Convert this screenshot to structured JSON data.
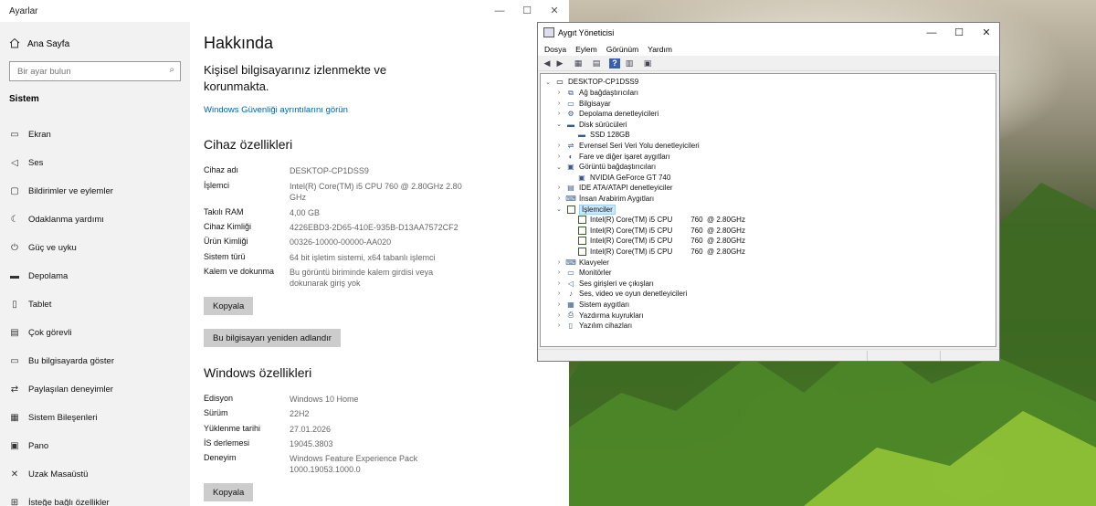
{
  "settings": {
    "app_title": "Ayarlar",
    "home_label": "Ana Sayfa",
    "search_placeholder": "Bir ayar bulun",
    "section_label": "Sistem",
    "nav_items": [
      {
        "label": "Ekran",
        "icon": "monitor-icon"
      },
      {
        "label": "Ses",
        "icon": "speaker-icon"
      },
      {
        "label": "Bildirimler ve eylemler",
        "icon": "notification-icon"
      },
      {
        "label": "Odaklanma yardımı",
        "icon": "moon-icon"
      },
      {
        "label": "Güç ve uyku",
        "icon": "power-icon"
      },
      {
        "label": "Depolama",
        "icon": "storage-icon"
      },
      {
        "label": "Tablet",
        "icon": "tablet-icon"
      },
      {
        "label": "Çok görevli",
        "icon": "multitask-icon"
      },
      {
        "label": "Bu bilgisayarda göster",
        "icon": "project-icon"
      },
      {
        "label": "Paylaşılan deneyimler",
        "icon": "shared-icon"
      },
      {
        "label": "Sistem Bileşenleri",
        "icon": "components-icon"
      },
      {
        "label": "Pano",
        "icon": "clipboard-icon"
      },
      {
        "label": "Uzak Masaüstü",
        "icon": "remote-icon"
      },
      {
        "label": "İsteğe bağlı özellikler",
        "icon": "features-icon"
      }
    ],
    "page_title": "Hakkında",
    "status_text": "Kişisel bilgisayarınız izlenmekte ve korunmakta.",
    "security_link": "Windows Güvenliği ayrıntılarını görün",
    "device_section_title": "Cihaz özellikleri",
    "device_specs": [
      {
        "key": "Cihaz adı",
        "value": "DESKTOP-CP1DSS9"
      },
      {
        "key": "İşlemci",
        "value": "Intel(R) Core(TM) i5 CPU         760  @ 2.80GHz   2.80 GHz"
      },
      {
        "key": "Takılı RAM",
        "value": "4,00 GB"
      },
      {
        "key": "Cihaz Kimliği",
        "value": "4226EBD3-2D65-410E-935B-D13AA7572CF2"
      },
      {
        "key": "Ürün Kimliği",
        "value": "00326-10000-00000-AA020"
      },
      {
        "key": "Sistem türü",
        "value": "64 bit işletim sistemi, x64 tabanlı işlemci"
      },
      {
        "key": "Kalem ve dokunma",
        "value": "Bu görüntü biriminde kalem girdisi veya dokunarak giriş yok"
      }
    ],
    "copy_label": "Kopyala",
    "rename_label": "Bu bilgisayarı yeniden adlandır",
    "windows_section_title": "Windows özellikleri",
    "windows_specs": [
      {
        "key": "Edisyon",
        "value": "Windows 10 Home"
      },
      {
        "key": "Sürüm",
        "value": "22H2"
      },
      {
        "key": "Yüklenme tarihi",
        "value": "27.01.2026"
      },
      {
        "key": "İS derlemesi",
        "value": "19045.3803"
      },
      {
        "key": "Deneyim",
        "value": "Windows Feature Experience Pack 1000.19053.1000.0"
      }
    ],
    "copy_label_2": "Kopyala"
  },
  "devmgr": {
    "title": "Aygıt Yöneticisi",
    "menu": [
      "Dosya",
      "Eylem",
      "Görünüm",
      "Yardım"
    ],
    "root": "DESKTOP-CP1DSS9",
    "nodes": [
      {
        "label": "Ağ bağdaştırıcıları",
        "level": 1,
        "exp": "collapsed",
        "icon": "network-icon"
      },
      {
        "label": "Bilgisayar",
        "level": 1,
        "exp": "collapsed",
        "icon": "computer-icon"
      },
      {
        "label": "Depolama denetleyicileri",
        "level": 1,
        "exp": "collapsed",
        "icon": "storage-controller-icon"
      },
      {
        "label": "Disk sürücüleri",
        "level": 1,
        "exp": "expanded",
        "icon": "disk-icon"
      },
      {
        "label": "SSD 128GB",
        "level": 2,
        "exp": "none",
        "icon": "disk-icon"
      },
      {
        "label": "Evrensel Seri Veri Yolu denetleyicileri",
        "level": 1,
        "exp": "collapsed",
        "icon": "usb-icon"
      },
      {
        "label": "Fare ve diğer işaret aygıtları",
        "level": 1,
        "exp": "collapsed",
        "icon": "mouse-icon"
      },
      {
        "label": "Görüntü bağdaştırıcıları",
        "level": 1,
        "exp": "expanded",
        "icon": "display-adapter-icon"
      },
      {
        "label": "NVIDIA GeForce GT 740",
        "level": 2,
        "exp": "none",
        "icon": "display-adapter-icon"
      },
      {
        "label": "IDE ATA/ATAPI denetleyiciler",
        "level": 1,
        "exp": "collapsed",
        "icon": "ide-icon"
      },
      {
        "label": "İnsan Arabirim Aygıtları",
        "level": 1,
        "exp": "collapsed",
        "icon": "hid-icon"
      },
      {
        "label": "İşlemciler",
        "level": 1,
        "exp": "expanded",
        "icon": "cpu-icon",
        "selected": true
      },
      {
        "label": "Intel(R) Core(TM) i5 CPU         760  @ 2.80GHz",
        "level": 2,
        "exp": "none",
        "icon": "cpu-icon"
      },
      {
        "label": "Intel(R) Core(TM) i5 CPU         760  @ 2.80GHz",
        "level": 2,
        "exp": "none",
        "icon": "cpu-icon"
      },
      {
        "label": "Intel(R) Core(TM) i5 CPU         760  @ 2.80GHz",
        "level": 2,
        "exp": "none",
        "icon": "cpu-icon"
      },
      {
        "label": "Intel(R) Core(TM) i5 CPU         760  @ 2.80GHz",
        "level": 2,
        "exp": "none",
        "icon": "cpu-icon"
      },
      {
        "label": "Klavyeler",
        "level": 1,
        "exp": "collapsed",
        "icon": "keyboard-icon"
      },
      {
        "label": "Monitörler",
        "level": 1,
        "exp": "collapsed",
        "icon": "monitor-icon"
      },
      {
        "label": "Ses girişleri ve çıkışları",
        "level": 1,
        "exp": "collapsed",
        "icon": "audio-icon"
      },
      {
        "label": "Ses, video ve oyun denetleyicileri",
        "level": 1,
        "exp": "collapsed",
        "icon": "sound-icon"
      },
      {
        "label": "Sistem aygıtları",
        "level": 1,
        "exp": "collapsed",
        "icon": "system-device-icon"
      },
      {
        "label": "Yazdırma kuyrukları",
        "level": 1,
        "exp": "collapsed",
        "icon": "printer-icon"
      },
      {
        "label": "Yazılım cihazları",
        "level": 1,
        "exp": "collapsed",
        "icon": "software-device-icon"
      }
    ]
  },
  "colors": {
    "link": "#0063b1",
    "sidebar_bg": "#f2f2f2",
    "button_bg": "#cccccc",
    "selection": "#cce8ff"
  }
}
